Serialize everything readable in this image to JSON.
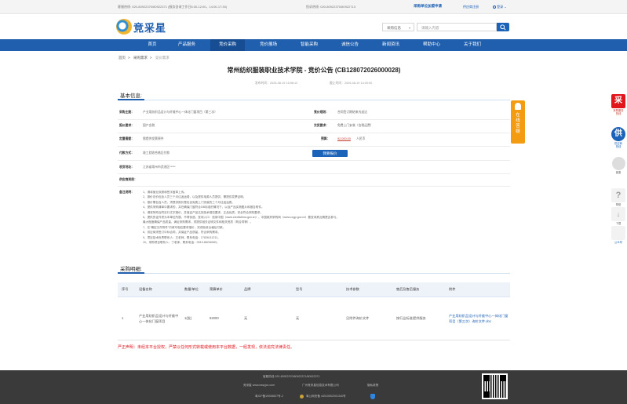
{
  "topbar": {
    "service_hotline": "客服热线: 020-80922370/80922371 (服务咨询工作日8:30-12:00，14:00-17:30)",
    "report_hotline": "投诉热线: 020-80922370/80922713",
    "supplier_apply": "采购单位加盟申请",
    "supplier_notice": "供应商注册",
    "login": "登录"
  },
  "header": {
    "logo_cn": "竞采星",
    "logo_en": "JING CAI XING",
    "search_select": "采购信息",
    "search_placeholder": "请输入内容"
  },
  "nav": {
    "items": [
      "首页",
      "产品服务",
      "竞价采购",
      "竞价展场",
      "智能采购",
      "诚信公告",
      "新闻资讯",
      "帮助中心",
      "关于我们"
    ]
  },
  "breadcrumb": {
    "items": [
      "首页",
      "采购需求"
    ],
    "current": "竞价需求"
  },
  "page_title": "常州纺织服装职业技术学院 - 竞价公告 (CB128072026000028)",
  "meta": {
    "start_label": "发布时间：2026-08-19 15:58:12",
    "end_label": "截止时间：2026-08-19 14:00:00"
  },
  "basic": {
    "heading": "基本信息:",
    "project_label": "采购主题：",
    "project_value": "产业用纺织品设计与纤维中心一体化门窗项目（第三次）",
    "bid_method_label": "竞价规则：",
    "bid_method_value": "合同签订期结束内送达",
    "req_label": "报价要求：",
    "req_value": "国产含税",
    "delivery_label": "交货要求：",
    "delivery_value": "免费上门安装（含税运费）",
    "quote_req_label": "定量需要：",
    "quote_req_value": "需提供发票原件",
    "budget_label": "预算：",
    "budget_value": "92,000.00",
    "budget_unit": "人民币",
    "pay_label": "付款方式：",
    "pay_value": "竣工验收合格后付款",
    "bid_button": "我要报价",
    "addr_label": "收货地址：",
    "addr_value": "江苏省常州市武进区*****",
    "supplier_label": "供应商资质：",
    "notes_label": "备注说明：",
    "notes": [
      "1、请将营业执照和签字盖章上传。",
      "2、报价总价包含人员三个月往返运费，以及提供电源人员提供，需提供发票证明。",
      "3、报价需包含人员，须提供报价是包含免费上门安装的三个月往返运费。",
      "4、提供采购清单中要求的，并在确保门窗符合GB标准的情况下，以及产品实物图片和报告附件。",
      "5、请将所附合同实行文字报价，并保证产品达到技术规范要求，正品优质，完全符合采购要求。",
      "6、提供的证件须为本单位所属，不得伪造，查询入口：信用中国（www.creditchina.gov.cn）、中国政府采购网（www.ccgp.gov.cn）要查询其近期是否参与。",
      "   最大程度确保产品质量，满足采购需求，须提供相关证明文件和相关资质（附合同等）。",
      "7、在\"确定文件附件\"内填写相应要求报价，完成验收合格后付款。",
      "8、供应商须签订中标合同，并保证产品质量，符合采购需求。",
      "9、项目技术负责联系人：王老师，联系电话：17826111211。",
      "10、采购项目联系人：丁老师，联系电话：0519-86236083。"
    ]
  },
  "float_notice": "在线答疑",
  "procurement": {
    "heading": "采购明细:",
    "columns": [
      "序号",
      "设备名称",
      "数量/单位",
      "预算单价",
      "品牌",
      "型号",
      "技术参数",
      "售后及售后服务",
      "附件"
    ],
    "rows": [
      {
        "no": "1",
        "name": "产业用纺织品设计与纤维中心一体化门窗项目",
        "qty": "1(批)",
        "price": "92000",
        "brand": "无",
        "model": "无",
        "spec": "见附件询价文件",
        "service": "按行业标准提供服务",
        "attach": "产业用纺织品设计与纤维中心一体化门窗项目（第三次）询价文件.doc"
      }
    ]
  },
  "warning": "严正声明：未经本平台授权，严禁以任何形式转载或使用本平台数据，一经发现，依法追究法律责任。",
  "footer": {
    "line1": "客服热线 020-80922370/80922371/80922371",
    "line2_a": "竞采星 www.easyjcx.com",
    "line2_b": "广州竞采星信息技术有限公司",
    "line2_c": "隐私政策",
    "icp": "粤ICP备19008837号-2",
    "police": "粤公网安备 44010502001340号"
  },
  "sidefloat": {
    "buy_label": "采",
    "buy_text1": "采购服务",
    "buy_text2": "热线",
    "supply_label": "供",
    "supply_text1": "供应商",
    "supply_text2": "热线",
    "service_text": "客服",
    "help_text": "帮助",
    "download_text": "下载",
    "wechat_text": "公众号"
  },
  "colors": {
    "brand_blue": "#1f5fae",
    "accent_orange": "#f39c12",
    "warning_red": "#e0161c"
  }
}
